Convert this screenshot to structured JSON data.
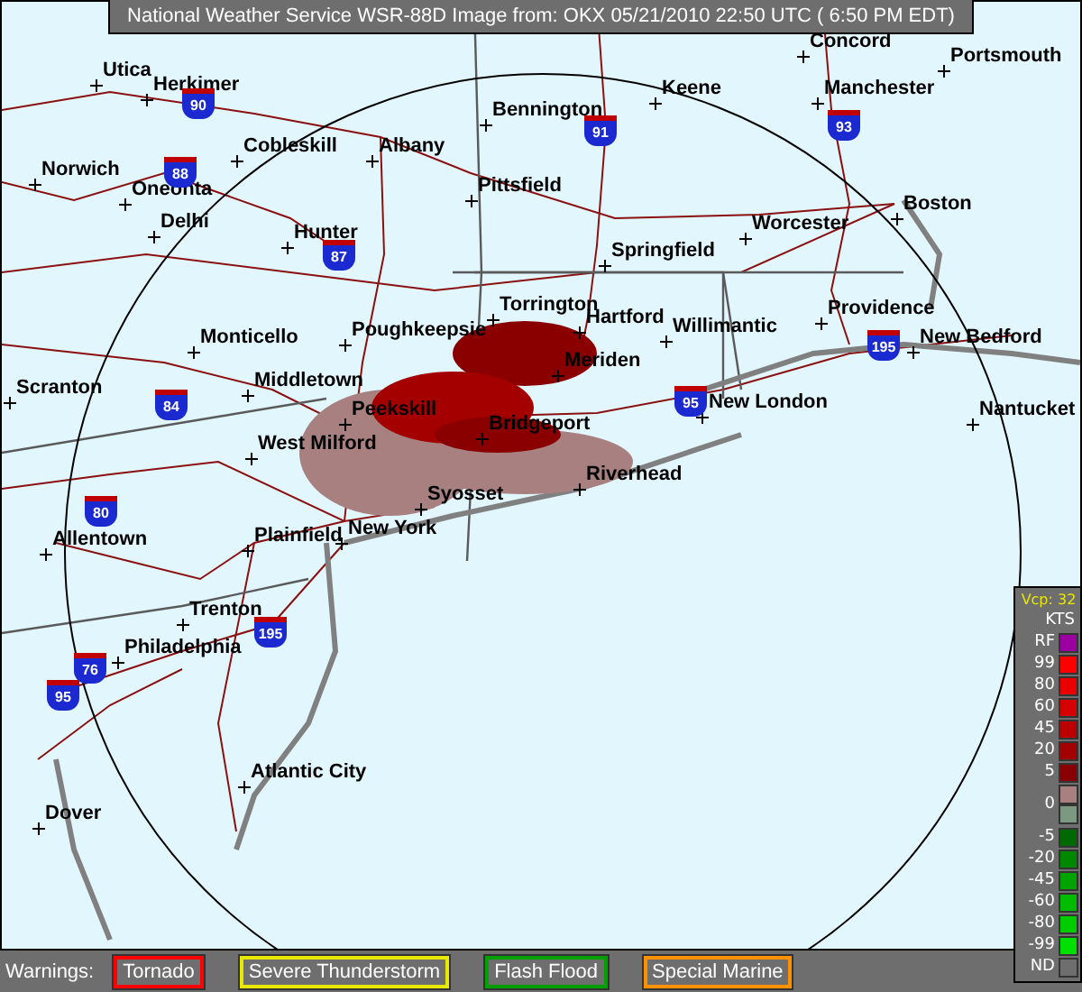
{
  "title_bar": {
    "text": "National Weather Service WSR-88D Image from: OKX 05/21/2010 22:50 UTC ( 6:50 PM EDT)"
  },
  "map": {
    "cities": [
      {
        "name": "Concord"
      },
      {
        "name": "Utica"
      },
      {
        "name": "Herkimer"
      },
      {
        "name": "Portsmouth"
      },
      {
        "name": "Keene"
      },
      {
        "name": "Manchester"
      },
      {
        "name": "Bennington"
      },
      {
        "name": "Cobleskill"
      },
      {
        "name": "Albany"
      },
      {
        "name": "Norwich"
      },
      {
        "name": "Oneonta"
      },
      {
        "name": "Pittsfield"
      },
      {
        "name": "Boston"
      },
      {
        "name": "Delhi"
      },
      {
        "name": "Worcester"
      },
      {
        "name": "Hunter"
      },
      {
        "name": "Springfield"
      },
      {
        "name": "Monticello"
      },
      {
        "name": "Poughkeepsie"
      },
      {
        "name": "Torrington"
      },
      {
        "name": "Hartford"
      },
      {
        "name": "Willimantic"
      },
      {
        "name": "Providence"
      },
      {
        "name": "New Bedford"
      },
      {
        "name": "Meriden"
      },
      {
        "name": "Middletown"
      },
      {
        "name": "Scranton"
      },
      {
        "name": "New London"
      },
      {
        "name": "Peekskill"
      },
      {
        "name": "Nantucket"
      },
      {
        "name": "Bridgeport"
      },
      {
        "name": "West Milford"
      },
      {
        "name": "Riverhead"
      },
      {
        "name": "Syosset"
      },
      {
        "name": "New York"
      },
      {
        "name": "Allentown"
      },
      {
        "name": "Plainfield"
      },
      {
        "name": "Trenton"
      },
      {
        "name": "Philadelphia"
      },
      {
        "name": "Atlantic City"
      },
      {
        "name": "Dover"
      }
    ],
    "highways": [
      {
        "number": "90"
      },
      {
        "number": "93"
      },
      {
        "number": "91"
      },
      {
        "number": "88"
      },
      {
        "number": "87"
      },
      {
        "number": "195"
      },
      {
        "number": "84"
      },
      {
        "number": "95"
      },
      {
        "number": "80"
      },
      {
        "number": "195"
      },
      {
        "number": "76"
      },
      {
        "number": "95"
      }
    ]
  },
  "legend": {
    "vcp": "Vcp: 32",
    "unit": "KTS",
    "items": [
      {
        "label": "RF",
        "color": "#9c00a0"
      },
      {
        "label": "99",
        "color": "#ff0000"
      },
      {
        "label": "80",
        "color": "#ea0000"
      },
      {
        "label": "60",
        "color": "#d40000"
      },
      {
        "label": "45",
        "color": "#bc0000"
      },
      {
        "label": "20",
        "color": "#a40000"
      },
      {
        "label": "5",
        "color": "#8a0000"
      },
      {
        "label": "0",
        "color": "#a88080"
      },
      {
        "kind": "unlabeled",
        "color": "#7c9880"
      },
      {
        "label": "-5",
        "color": "#006a00"
      },
      {
        "label": "-20",
        "color": "#008800"
      },
      {
        "label": "-45",
        "color": "#00a400"
      },
      {
        "label": "-60",
        "color": "#00bc00"
      },
      {
        "label": "-80",
        "color": "#00cc00"
      },
      {
        "label": "-99",
        "color": "#00e000"
      },
      {
        "label": "ND",
        "color": "#6e6e6e"
      }
    ]
  },
  "warnings": {
    "label": "Warnings:",
    "items": [
      {
        "label": "Tornado",
        "color": "#ff0000"
      },
      {
        "label": "Severe Thunderstorm",
        "color": "#e8e800"
      },
      {
        "label": "Flash Flood",
        "color": "#00a000"
      },
      {
        "label": "Special Marine",
        "color": "#ff9000"
      }
    ]
  }
}
